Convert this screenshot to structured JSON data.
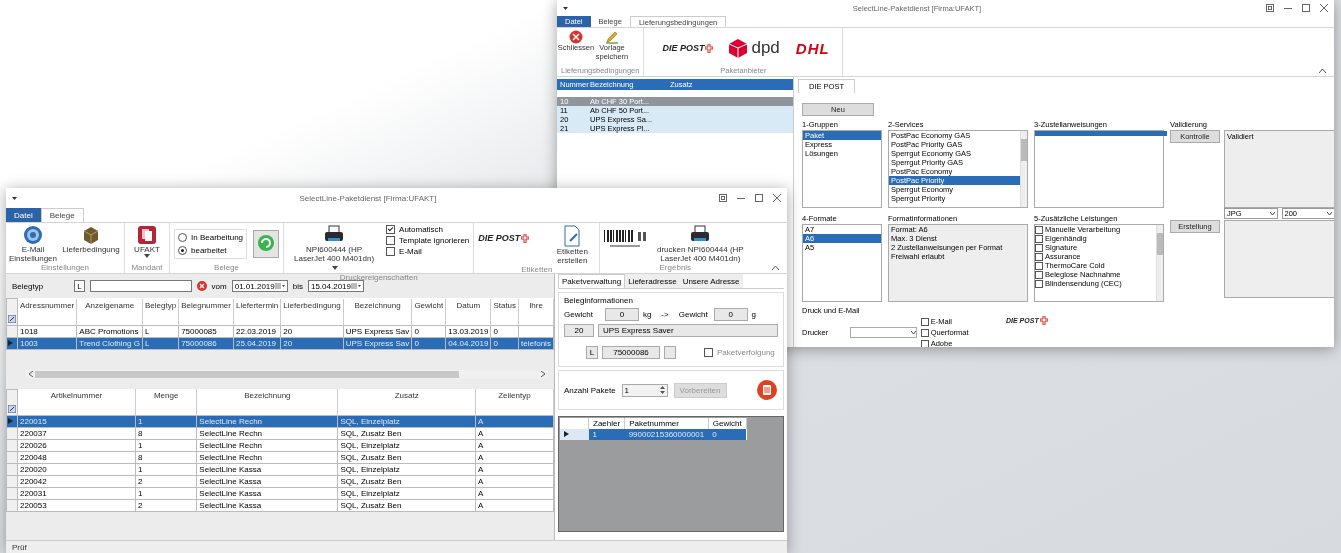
{
  "back_window": {
    "title": "SelectLine-Paketdienst [Firma:UFAKT]",
    "tabs": [
      {
        "label": "Datei",
        "kind": "file",
        "selected": false
      },
      {
        "label": "Belege",
        "kind": "tab",
        "selected": false
      },
      {
        "label": "Lieferungsbedingungen",
        "kind": "tab",
        "selected": true
      }
    ],
    "ribbon": {
      "actions_group": {
        "label": "Lieferungsbedingungen",
        "buttons": [
          {
            "label": "Schliessen",
            "kind": "close"
          },
          {
            "label": "Vorlage speichern",
            "kind": "save"
          }
        ]
      },
      "carriers_group": {
        "label": "Paketanbieter",
        "logos": [
          {
            "label": "DIE POST",
            "kind": "post"
          },
          {
            "label": "dpd",
            "kind": "dpd"
          },
          {
            "label": "DHL",
            "kind": "dhl"
          }
        ]
      }
    },
    "conditions": {
      "columns": [
        "Nummer",
        "Bezeichnung",
        "Zusatz"
      ],
      "rows": [
        {
          "cells": [
            "10",
            "Ab CHF 30 Port..."
          ],
          "selected": true
        },
        {
          "cells": [
            "11",
            "Ab CHF 50 Port..."
          ],
          "selected": false
        },
        {
          "cells": [
            "20",
            "UPS Express Sa..."
          ],
          "selected": false
        },
        {
          "cells": [
            "21",
            "UPS Express Pl..."
          ],
          "selected": false
        }
      ]
    },
    "editor": {
      "tab": "DIE POST",
      "new_button": "Neu",
      "panels": [
        {
          "kind": "list",
          "label": "1-Gruppen",
          "items": [
            {
              "label": "Paket",
              "selected": true
            },
            {
              "label": "Express",
              "selected": false
            },
            {
              "label": "Lösungen",
              "selected": false
            }
          ]
        },
        {
          "kind": "scroll-list",
          "label": "2-Services",
          "items": [
            {
              "label": "PostPac Economy GAS",
              "selected": false
            },
            {
              "label": "PostPac Priority GAS",
              "selected": false
            },
            {
              "label": "Sperrgut Economy GAS",
              "selected": false
            },
            {
              "label": "Sperrgut Priority GAS",
              "selected": false
            },
            {
              "label": "PostPac Economy",
              "selected": false
            },
            {
              "label": "PostPac Priority",
              "selected": true
            },
            {
              "label": "Sperrgut Economy",
              "selected": false
            },
            {
              "label": "Sperrgut Priority",
              "selected": false
            }
          ]
        },
        {
          "kind": "blank-list",
          "label": "3-Zustellanweisungen"
        },
        {
          "kind": "validation",
          "label": "Validierung",
          "button": "Kontrolle",
          "value": "Validiert"
        },
        {
          "kind": "list",
          "label": "4-Formate",
          "items": [
            {
              "label": "A7",
              "selected": false
            },
            {
              "label": "A6",
              "selected": true
            },
            {
              "label": "A5",
              "selected": false
            }
          ]
        },
        {
          "kind": "info",
          "label": "Formatinformationen",
          "lines": [
            "Format: A6",
            "Max. 3 Dienst",
            "2 Zustellanweisungen per Format",
            "Freiwahl erlaubt"
          ]
        },
        {
          "kind": "check-list",
          "label": "5-Zusätzliche Leistungen",
          "items": [
            {
              "label": "Manuelle Verarbeitung",
              "checked": false
            },
            {
              "label": "Eigenhändig",
              "checked": false
            },
            {
              "label": "Signature",
              "checked": false
            },
            {
              "label": "Assurance",
              "checked": false
            },
            {
              "label": "ThermoCare Cold",
              "checked": false
            },
            {
              "label": "Beleglose Nachnahme",
              "checked": false
            },
            {
              "label": "Blindensendung (CEC)",
              "checked": false
            }
          ]
        },
        {
          "kind": "output",
          "button": "Erstellung",
          "format": "JPG",
          "resolution": "200"
        }
      ],
      "print": {
        "label": "Druck und E-Mail",
        "printer_label": "Drucker",
        "options": [
          {
            "label": "E-Mail",
            "checked": false
          },
          {
            "label": "Querformat",
            "checked": false
          },
          {
            "label": "Adobe",
            "checked": false
          }
        ]
      },
      "logo": "DIE POST"
    }
  },
  "front_window": {
    "title": "SelectLine-Paketdienst [Firma:UFAKT]",
    "tabs": [
      {
        "label": "Datei",
        "kind": "file",
        "selected": false
      },
      {
        "label": "Belege",
        "kind": "tab",
        "selected": true
      }
    ],
    "ribbon": {
      "settings_group": {
        "label": "Einstellungen",
        "buttons": [
          "E-Mail Einstellungen",
          "Lieferbedingung"
        ]
      },
      "client_group": {
        "label": "Mandant",
        "button": "UFAKT"
      },
      "documents_group": {
        "label": "Belege",
        "options": [
          {
            "label": "In Bearbeitung",
            "selected": false
          },
          {
            "label": "bearbeitet",
            "selected": true
          }
        ]
      },
      "printer_group": {
        "label": "Druckereigenschaften",
        "printer": "NPI600444 (HP LaserJet 400 M401dn)",
        "options": [
          {
            "label": "Automatisch",
            "checked": true
          },
          {
            "label": "Template ignorieren",
            "checked": false
          },
          {
            "label": "E-Mail",
            "checked": false
          }
        ]
      },
      "labels_group": {
        "label": "Etiketten",
        "logo": "DIE POST",
        "button": "Etiketten erstellen"
      },
      "result_group": {
        "label": "Ergebnis",
        "button": "drucken NPI600444 (HP LaserJet 400 M401dn)"
      }
    },
    "filter": {
      "label": "Belegtyp",
      "type_code": "L",
      "from_label": "vom",
      "from": "01.01.2019",
      "to_label": "bis",
      "to": "15.04.2019"
    },
    "documents": {
      "columns": [
        "Adressnummer",
        "Anzeigename",
        "Belegtyp",
        "Belegnummer",
        "Liefertermin",
        "Lieferbedingung",
        "Bezeichnung",
        "Gewicht",
        "Datum",
        "Status",
        "Ihre"
      ],
      "rows": [
        {
          "cells": [
            "1018",
            "ABC Promotions",
            "L",
            "75000085",
            "22.03.2019",
            "20",
            "UPS Express Sav",
            "0",
            "13.03.2019",
            "0",
            ""
          ],
          "selected": false
        },
        {
          "cells": [
            "1003",
            "Trend Clothing G",
            "L",
            "75000086",
            "25.04.2019",
            "20",
            "UPS Express Sav",
            "0",
            "04.04.2019",
            "0",
            "telefonis"
          ],
          "selected": true
        }
      ]
    },
    "articles": {
      "columns": [
        "Artikelnummer",
        "Menge",
        "Bezeichnung",
        "Zusatz",
        "Zeilentyp"
      ],
      "rows": [
        {
          "cells": [
            "220015",
            "1",
            "SelectLine Rechn",
            "SQL, Einzelplatz",
            "A"
          ],
          "selected": true
        },
        {
          "cells": [
            "220037",
            "8",
            "SelectLine Rechn",
            "SQL, Zusatz Ben",
            "A"
          ],
          "selected": false
        },
        {
          "cells": [
            "220026",
            "1",
            "SelectLine Rechn",
            "SQL, Einzelplatz",
            "A"
          ],
          "selected": false
        },
        {
          "cells": [
            "220048",
            "8",
            "SelectLine Rechn",
            "SQL, Zusatz Ben",
            "A"
          ],
          "selected": false
        },
        {
          "cells": [
            "220020",
            "1",
            "SelectLine Kassa",
            "SQL, Einzelplatz",
            "A"
          ],
          "selected": false
        },
        {
          "cells": [
            "220042",
            "2",
            "SelectLine Kassa",
            "SQL, Zusatz Ben",
            "A"
          ],
          "selected": false
        },
        {
          "cells": [
            "220031",
            "1",
            "SelectLine Kassa",
            "SQL, Einzelplatz",
            "A"
          ],
          "selected": false
        },
        {
          "cells": [
            "220053",
            "2",
            "SelectLine Kassa",
            "SQL, Zusatz Ben",
            "A"
          ],
          "selected": false
        }
      ]
    },
    "panel": {
      "tabs": [
        {
          "label": "Paketverwaltung",
          "selected": true
        },
        {
          "label": "Lieferadresse",
          "selected": false
        },
        {
          "label": "Unsere Adresse",
          "selected": false
        }
      ],
      "info": {
        "label": "Beleginformationen",
        "weight_label": "Gewicht",
        "weight_kg": "0",
        "unit_kg": "kg",
        "arrow": "->",
        "weight_g_label": "Gewicht",
        "weight_g": "0",
        "unit_g": "g",
        "service_code": "20",
        "service": "UPS Express Saver",
        "type_code": "L",
        "number": "75000086",
        "tracking": {
          "label": "Paketverfolgung",
          "checked": false
        }
      },
      "packages": {
        "label": "Anzahl Pakete",
        "count": "1",
        "prepare_button": "Vorbereiten"
      },
      "grid": {
        "columns": [
          "Zaehler",
          "Paketnummer",
          "Gewicht"
        ],
        "rows": [
          {
            "cells": [
              "1",
              "99000215360000001",
              "0"
            ],
            "selected": true
          }
        ]
      }
    },
    "status_bar": "Prüf"
  }
}
